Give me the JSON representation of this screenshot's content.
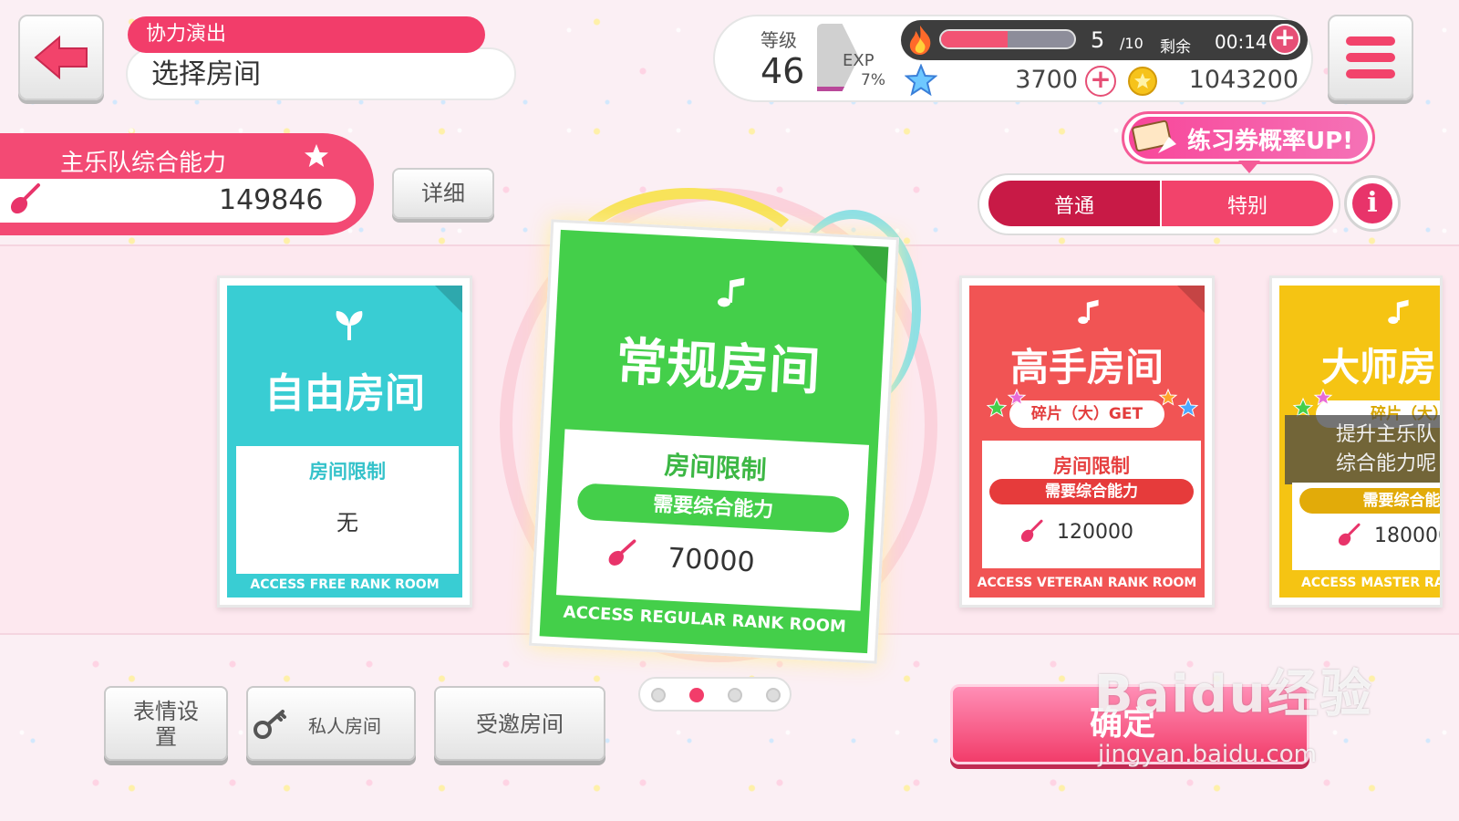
{
  "header": {
    "mode_label": "协力演出",
    "page_title": "选择房间"
  },
  "status": {
    "level_label": "等级",
    "level": "46",
    "exp_label": "EXP",
    "exp_percent": "7%",
    "exp_fraction": 0.07,
    "stamina_current": "5",
    "stamina_max": "/10",
    "stamina_fraction": 0.5,
    "remain_label": "剩余",
    "remain_time": "00:14",
    "stars": "3700",
    "coins": "1043200",
    "plus_symbol": "+"
  },
  "band": {
    "power_label": "主乐队综合能力",
    "power_value": "149846",
    "detail_button": "详细"
  },
  "ticket_banner": "练习券概率UP!",
  "modes": {
    "normal": "普通",
    "special": "特别",
    "info_symbol": "i"
  },
  "rooms": [
    {
      "title": "自由房间",
      "limit_label": "房间限制",
      "requirement": "",
      "value": "无",
      "access": "ACCESS FREE RANK ROOM",
      "color": "#39cdd3"
    },
    {
      "title": "常规房间",
      "limit_label": "房间限制",
      "requirement": "需要综合能力",
      "value": "70000",
      "access": "ACCESS REGULAR RANK ROOM",
      "color": "#44cf4a"
    },
    {
      "title": "高手房间",
      "shard_text": "碎片（大）GET",
      "limit_label": "房间限制",
      "requirement": "需要综合能力",
      "value": "120000",
      "access": "ACCESS VETERAN RANK ROOM",
      "color": "#f15454"
    },
    {
      "title": "大师房",
      "shard_text": "碎片（大）(",
      "lock_text_1": "提升主乐队",
      "lock_text_2": "综合能力呢",
      "requirement": "需要综合能",
      "value": "180000",
      "access": "ACCESS MASTER RA",
      "color": "#f5c413"
    }
  ],
  "bottom": {
    "face_settings": "表情设置",
    "private_room": "私人房间",
    "invited_room": "受邀房间",
    "confirm": "确定"
  },
  "pagination": {
    "total": 4,
    "active_index": 1
  },
  "watermark": {
    "logo": "Baidu经验",
    "url": "jingyan.baidu.com"
  }
}
